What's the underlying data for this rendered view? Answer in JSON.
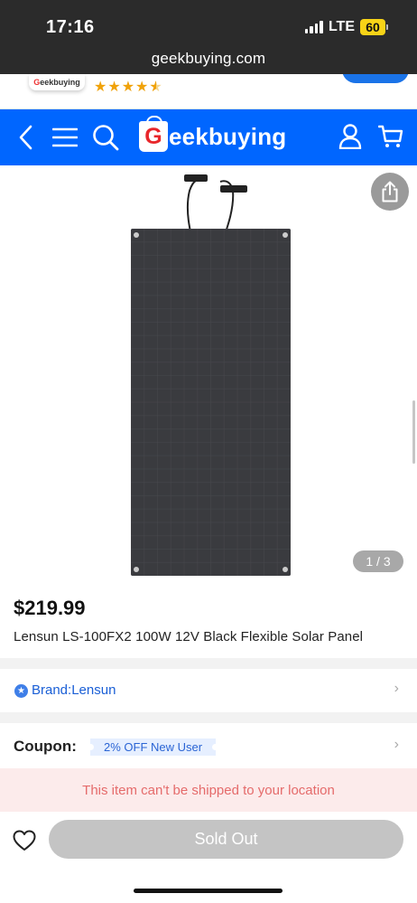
{
  "status": {
    "time": "17:16",
    "network": "LTE",
    "battery": "60"
  },
  "browser": {
    "url": "geekbuying.com"
  },
  "app_banner": {
    "logo_text_g": "G",
    "logo_text_rest": "eekbuying",
    "rating": 4.5,
    "stars": "★★★★☆"
  },
  "nav": {
    "brand_g": "G",
    "brand_rest": "eekbuying"
  },
  "gallery": {
    "counter": "1 / 3"
  },
  "product": {
    "price": "$219.99",
    "title": "Lensun LS-100FX2 100W 12V Black Flexible Solar Panel"
  },
  "brand": {
    "label": "Brand:Lensun"
  },
  "coupon": {
    "label": "Coupon:",
    "tag": "2% OFF New User"
  },
  "shipping_warning": "This item can't be shipped to your location",
  "actions": {
    "sold_out": "Sold Out"
  },
  "icons": {
    "back": "chevron-left-icon",
    "menu": "menu-icon",
    "search": "search-icon",
    "account": "user-icon",
    "cart": "cart-icon",
    "share": "share-icon",
    "wishlist": "heart-icon",
    "brand_badge": "star-badge-icon"
  },
  "colors": {
    "nav_blue": "#0066ff",
    "link_blue": "#1a5fd6",
    "warning_bg": "#fcebeb",
    "warning_text": "#e56b6b",
    "star": "#f0a20a"
  }
}
